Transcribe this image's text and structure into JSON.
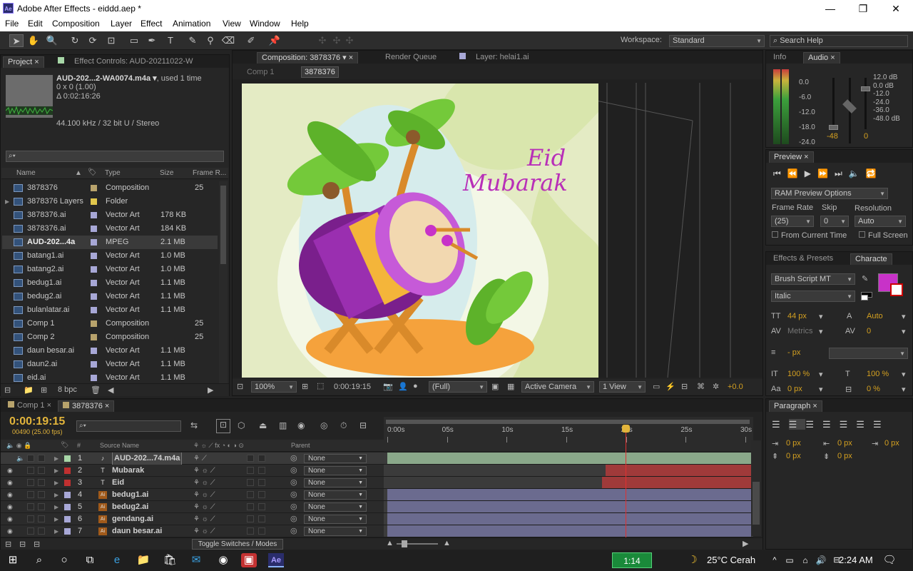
{
  "window": {
    "title": "Adobe After Effects - eiddd.aep *",
    "app_icon": "Ae"
  },
  "menu": [
    "File",
    "Edit",
    "Composition",
    "Layer",
    "Effect",
    "Animation",
    "View",
    "Window",
    "Help"
  ],
  "toolbar": {
    "workspace_label": "Workspace:",
    "workspace_value": "Standard",
    "search_placeholder": "Search Help"
  },
  "project_panel": {
    "tab_project": "Project",
    "tab_effects": "Effect Controls: AUD-20211022-W",
    "selected_name": "AUD-202...2-WA0074.m4a",
    "used": ", used 1 time",
    "dims": "0 x 0 (1.00)",
    "duration": "Δ 0:02:16:26",
    "audio": "44.100 kHz / 32 bit U / Stereo",
    "columns": {
      "name": "Name",
      "type": "Type",
      "size": "Size",
      "frame": "Frame R..."
    },
    "items": [
      {
        "name": "3878376",
        "type": "Composition",
        "size": "",
        "fr": "25",
        "icon": "composition-icon",
        "label": "#b8a36c"
      },
      {
        "name": "3878376 Layers",
        "type": "Folder",
        "size": "",
        "fr": "",
        "icon": "folder-icon",
        "label": "#e2c74c"
      },
      {
        "name": "3878376.ai",
        "type": "Vector Art",
        "size": "178 KB",
        "fr": "",
        "icon": "ai-file-icon",
        "label": "#a7a7d6"
      },
      {
        "name": "3878376.ai",
        "type": "Vector Art",
        "size": "184 KB",
        "fr": "",
        "icon": "ai-file-icon",
        "label": "#a7a7d6"
      },
      {
        "name": "AUD-202...4a",
        "type": "MPEG",
        "size": "2.1 MB",
        "fr": "",
        "icon": "audio-file-icon",
        "label": "#a7a7d6"
      },
      {
        "name": "batang1.ai",
        "type": "Vector Art",
        "size": "1.0 MB",
        "fr": "",
        "icon": "ai-file-icon",
        "label": "#a7a7d6"
      },
      {
        "name": "batang2.ai",
        "type": "Vector Art",
        "size": "1.0 MB",
        "fr": "",
        "icon": "ai-file-icon",
        "label": "#a7a7d6"
      },
      {
        "name": "bedug1.ai",
        "type": "Vector Art",
        "size": "1.1 MB",
        "fr": "",
        "icon": "ai-file-icon",
        "label": "#a7a7d6"
      },
      {
        "name": "bedug2.ai",
        "type": "Vector Art",
        "size": "1.1 MB",
        "fr": "",
        "icon": "ai-file-icon",
        "label": "#a7a7d6"
      },
      {
        "name": "bulanlatar.ai",
        "type": "Vector Art",
        "size": "1.1 MB",
        "fr": "",
        "icon": "ai-file-icon",
        "label": "#a7a7d6"
      },
      {
        "name": "Comp 1",
        "type": "Composition",
        "size": "",
        "fr": "25",
        "icon": "composition-icon",
        "label": "#b8a36c"
      },
      {
        "name": "Comp 2",
        "type": "Composition",
        "size": "",
        "fr": "25",
        "icon": "composition-icon",
        "label": "#b8a36c"
      },
      {
        "name": "daun besar.ai",
        "type": "Vector Art",
        "size": "1.1 MB",
        "fr": "",
        "icon": "ai-file-icon",
        "label": "#a7a7d6"
      },
      {
        "name": "daun2.ai",
        "type": "Vector Art",
        "size": "1.1 MB",
        "fr": "",
        "icon": "ai-file-icon",
        "label": "#a7a7d6"
      },
      {
        "name": "eid.ai",
        "type": "Vector Art",
        "size": "1.1 MB",
        "fr": "",
        "icon": "ai-file-icon",
        "label": "#a7a7d6"
      }
    ],
    "bpc": "8 bpc"
  },
  "comp_panel": {
    "tab_comp": "Composition: 3878376",
    "tab_render": "Render Queue",
    "tab_layer": "Layer: helai1.ai",
    "crumb1": "Comp 1",
    "crumb2": "3878376",
    "art_eid": "Eid",
    "art_mubarak": "Mubarak",
    "zoom": "100%",
    "timecode": "0:00:19:15",
    "quality": "(Full)",
    "camera": "Active Camera",
    "view": "1 View",
    "exposure": "+0.0"
  },
  "info_panel": {
    "tab_info": "Info",
    "tab_audio": "Audio",
    "left_scale": [
      "0.0",
      "-6.0",
      "-12.0",
      "-18.0",
      "-24.0"
    ],
    "right_scale": [
      "12.0 dB",
      "0.0 dB",
      "-12.0",
      "-24.0",
      "-36.0",
      "-48.0 dB"
    ],
    "val_left": "-48",
    "val_right": "0"
  },
  "preview_panel": {
    "tab": "Preview",
    "ram_options": "RAM Preview Options",
    "frame_rate_label": "Frame Rate",
    "skip_label": "Skip",
    "resolution_label": "Resolution",
    "frame_rate": "(25)",
    "skip": "0",
    "resolution": "Auto",
    "from_current": "From Current Time",
    "full_screen": "Full Screen"
  },
  "character_panel": {
    "tab_effects": "Effects & Presets",
    "tab_char": "Characte",
    "font": "Brush Script MT",
    "style": "Italic",
    "size": "44 px",
    "leading": "Auto",
    "kerning": "Metrics",
    "tracking": "0",
    "stroke": "- px",
    "vscale": "100 %",
    "hscale": "100 %",
    "baseline": "0 px",
    "tsume": "0 %",
    "fill_color": "#c832c8"
  },
  "paragraph_panel": {
    "tab": "Paragraph",
    "indent1": "0 px",
    "indent2": "0 px",
    "indent3": "0 px",
    "space1": "0 px",
    "space2": "0 px"
  },
  "timeline": {
    "tab_comp1": "Comp 1",
    "tab_main": "3878376",
    "timecode": "0:00:19:15",
    "frames": "00490 (25.00 fps)",
    "col_source": "Source Name",
    "col_parent": "Parent",
    "ticks": [
      "0:00s",
      "05s",
      "10s",
      "15s",
      "20s",
      "25s",
      "30s"
    ],
    "toggle": "Toggle Switches / Modes",
    "layers": [
      {
        "num": "1",
        "name": "AUD-202...74.m4a",
        "parent": "None",
        "label": "#a7d6a7",
        "icon": "audio-layer-icon",
        "bar_start": 0.0,
        "bar_end": 1.0,
        "bar_color": "#8aa88a"
      },
      {
        "num": "2",
        "name": "Mubarak",
        "parent": "None",
        "label": "#c03030",
        "icon": "text-layer-icon",
        "bar_start": 0.6,
        "bar_end": 1.0,
        "bar_color": "#a03a3a"
      },
      {
        "num": "3",
        "name": "Eid",
        "parent": "None",
        "label": "#c03030",
        "icon": "text-layer-icon",
        "bar_start": 0.59,
        "bar_end": 1.0,
        "bar_color": "#a03a3a"
      },
      {
        "num": "4",
        "name": "bedug1.ai",
        "parent": "None",
        "label": "#a7a7d6",
        "icon": "ai-layer-icon",
        "bar_start": 0.0,
        "bar_end": 1.0,
        "bar_color": "#6b6b8f"
      },
      {
        "num": "5",
        "name": "bedug2.ai",
        "parent": "None",
        "label": "#a7a7d6",
        "icon": "ai-layer-icon",
        "bar_start": 0.0,
        "bar_end": 1.0,
        "bar_color": "#6b6b8f"
      },
      {
        "num": "6",
        "name": "gendang.ai",
        "parent": "None",
        "label": "#a7a7d6",
        "icon": "ai-layer-icon",
        "bar_start": 0.0,
        "bar_end": 1.0,
        "bar_color": "#6b6b8f"
      },
      {
        "num": "7",
        "name": "daun besar.ai",
        "parent": "None",
        "label": "#a7a7d6",
        "icon": "ai-layer-icon",
        "bar_start": 0.0,
        "bar_end": 1.0,
        "bar_color": "#6b6b8f"
      }
    ],
    "playhead": 0.655
  },
  "taskbar": {
    "battery_badge": "1:14",
    "weather": "25°C Cerah",
    "time": "2:24 AM"
  }
}
